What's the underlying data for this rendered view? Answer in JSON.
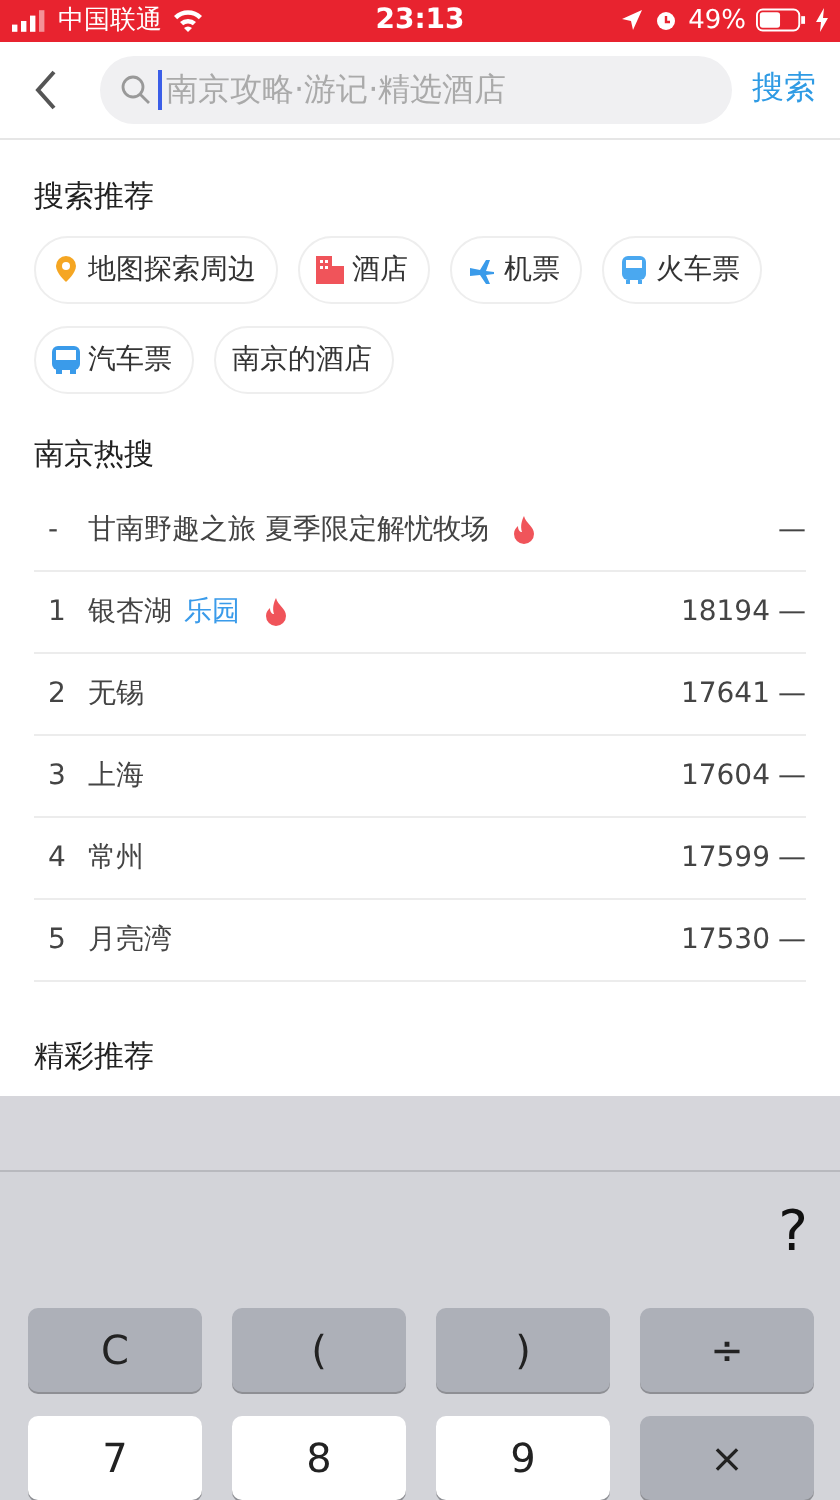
{
  "status_bar": {
    "carrier": "中国联通",
    "time": "23:13",
    "battery": "49%"
  },
  "header": {
    "placeholder": "南京攻略·游记·精选酒店",
    "search_button": "搜索"
  },
  "recommend": {
    "title": "搜索推荐",
    "chips": [
      {
        "label": "地图探索周边",
        "kind": "map"
      },
      {
        "label": "酒店",
        "kind": "hotel"
      },
      {
        "label": "机票",
        "kind": "flight"
      },
      {
        "label": "火车票",
        "kind": "train"
      },
      {
        "label": "汽车票",
        "kind": "bus"
      },
      {
        "label": "南京的酒店",
        "kind": "plain"
      }
    ]
  },
  "hot": {
    "title": "南京热搜",
    "rows": [
      {
        "rank": "-",
        "name": "甘南野趣之旅 夏季限定解忧牧场",
        "hot": true,
        "trend": "—"
      },
      {
        "rank": "1",
        "name": "银杏湖",
        "tag": "乐园",
        "hot": true,
        "count": "18194",
        "trend": "—"
      },
      {
        "rank": "2",
        "name": "无锡",
        "hot": false,
        "count": "17641",
        "trend": "—"
      },
      {
        "rank": "3",
        "name": "上海",
        "hot": false,
        "count": "17604",
        "trend": "—"
      },
      {
        "rank": "4",
        "name": "常州",
        "hot": false,
        "count": "17599",
        "trend": "—"
      },
      {
        "rank": "5",
        "name": "月亮湾",
        "hot": false,
        "count": "17530",
        "trend": "—"
      }
    ]
  },
  "featured": {
    "title": "精彩推荐"
  },
  "keyboard": {
    "hint": "?",
    "keys": [
      {
        "label": "C",
        "kind": "function"
      },
      {
        "label": "(",
        "kind": "function"
      },
      {
        "label": ")",
        "kind": "function"
      },
      {
        "label": "÷",
        "kind": "function"
      },
      {
        "label": "7",
        "kind": "digit"
      },
      {
        "label": "8",
        "kind": "digit"
      },
      {
        "label": "9",
        "kind": "digit"
      },
      {
        "label": "×",
        "kind": "function"
      }
    ]
  }
}
